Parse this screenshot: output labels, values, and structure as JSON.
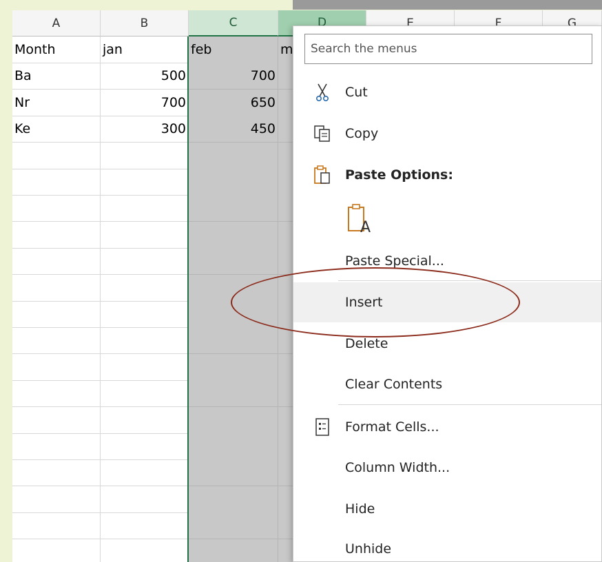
{
  "columns": [
    "A",
    "B",
    "C",
    "D",
    "E",
    "F",
    "G"
  ],
  "rows": [
    [
      "Month",
      "jan",
      "feb",
      "m"
    ],
    [
      "Ba",
      "500",
      "700",
      ""
    ],
    [
      "Nr",
      "700",
      "650",
      ""
    ],
    [
      "Ke",
      "300",
      "450",
      ""
    ]
  ],
  "menu": {
    "search_placeholder": "Search the menus",
    "cut": "Cut",
    "copy": "Copy",
    "paste_options": "Paste Options:",
    "paste_special": "Paste Special...",
    "insert": "Insert",
    "delete": "Delete",
    "clear_contents": "Clear Contents",
    "format_cells": "Format Cells...",
    "column_width": "Column Width...",
    "hide": "Hide",
    "unhide": "Unhide"
  },
  "colors": {
    "selection_green": "#217346",
    "annotation_ellipse": "#8b2a1a",
    "background": "#eef3d6"
  }
}
